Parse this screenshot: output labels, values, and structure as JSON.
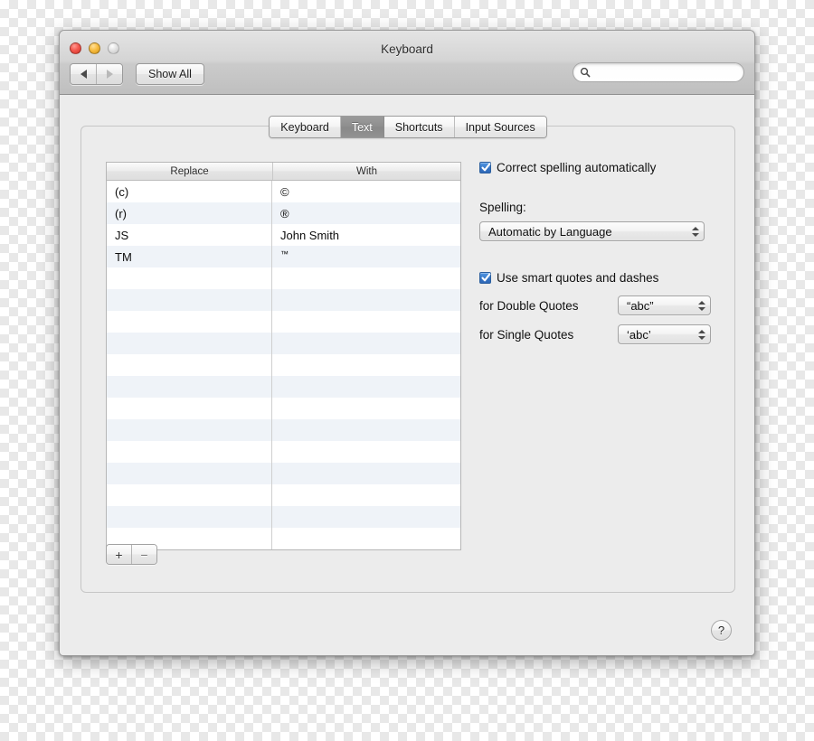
{
  "window": {
    "title": "Keyboard",
    "traffic_lights": [
      "close",
      "minimize",
      "zoom"
    ]
  },
  "toolbar": {
    "back_icon": "triangle-left-icon",
    "forward_icon": "triangle-right-icon",
    "show_all_label": "Show All",
    "search": {
      "icon": "search-icon",
      "value": "",
      "placeholder": ""
    }
  },
  "tabs": [
    {
      "label": "Keyboard",
      "selected": false
    },
    {
      "label": "Text",
      "selected": true
    },
    {
      "label": "Shortcuts",
      "selected": false
    },
    {
      "label": "Input Sources",
      "selected": false
    }
  ],
  "table": {
    "columns": [
      "Replace",
      "With"
    ],
    "rows": [
      {
        "replace": "(c)",
        "with": "©",
        "superscript": false
      },
      {
        "replace": "(r)",
        "with": "®",
        "superscript": false
      },
      {
        "replace": "JS",
        "with": "John Smith",
        "superscript": false
      },
      {
        "replace": "TM",
        "with": "™",
        "superscript": true
      }
    ],
    "empty_row_count": 13,
    "add_label": "+",
    "remove_label": "−"
  },
  "settings": {
    "correct_spelling": {
      "label": "Correct spelling automatically",
      "checked": true
    },
    "spelling": {
      "label": "Spelling:",
      "value": "Automatic by Language"
    },
    "smart_quotes": {
      "label": "Use smart quotes and dashes",
      "checked": true
    },
    "double_quotes": {
      "label": "for Double Quotes",
      "value": "“abc”"
    },
    "single_quotes": {
      "label": "for Single Quotes",
      "value": "‘abc’"
    }
  },
  "help": {
    "label": "?"
  },
  "colors": {
    "accent_checkbox": "#3d7ecd",
    "selected_tab_bg": "#8e8e8e",
    "window_bg": "#ececec",
    "row_stripe": "#eff3f8"
  }
}
